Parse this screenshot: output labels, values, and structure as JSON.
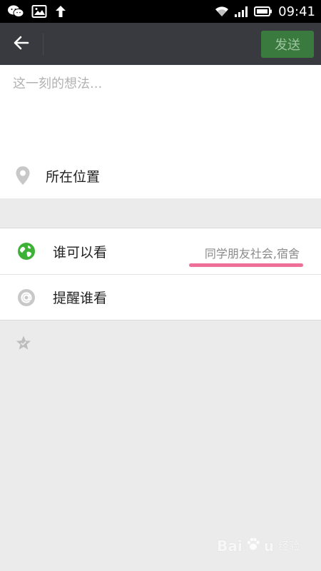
{
  "status_bar": {
    "time": "09:41",
    "icons": [
      "wechat-icon",
      "image-icon",
      "upload-arrow-icon",
      "wifi-icon",
      "signal-icon",
      "battery-icon"
    ]
  },
  "app_bar": {
    "send_label": "发送"
  },
  "compose": {
    "placeholder": "这一刻的想法...",
    "value": ""
  },
  "location": {
    "label": "所在位置"
  },
  "options": [
    {
      "label": "谁可以看",
      "value": "同学朋友社会,宿舍",
      "icon": "globe-icon"
    },
    {
      "label": "提醒谁看",
      "value": "",
      "icon": "at-icon"
    }
  ],
  "watermark": {
    "brand": "Bai",
    "brand_end": "u",
    "sub": "经验"
  },
  "colors": {
    "status_bar": "#000000",
    "app_bar": "#393a3f",
    "send_button_bg": "#3a7a3e",
    "send_button_text": "#9cc49f",
    "globe_green": "#3db236",
    "annotation_underline": "#ee6f97",
    "page_background": "#ebebeb"
  }
}
